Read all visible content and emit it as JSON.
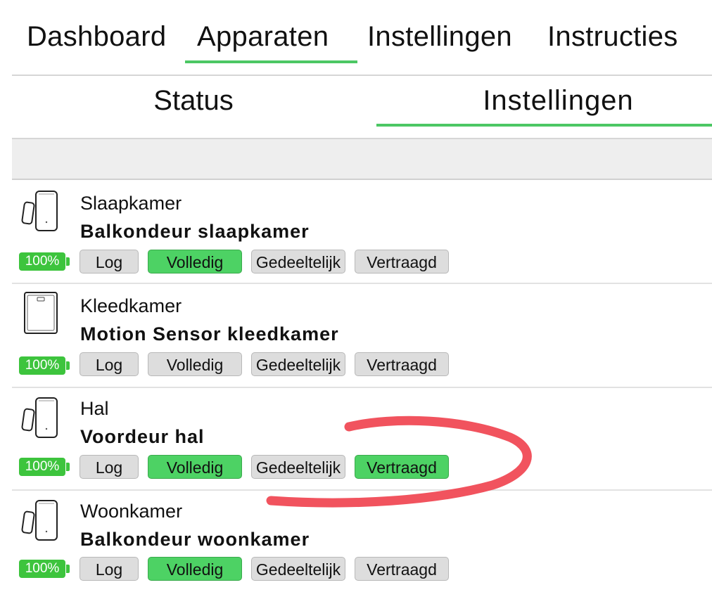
{
  "top_tabs": [
    {
      "label": "Dashboard"
    },
    {
      "label": "Apparaten"
    },
    {
      "label": "Instellingen"
    },
    {
      "label": "Instructies"
    }
  ],
  "top_tabs_active": "Apparaten",
  "sub_tabs": [
    {
      "label": "Status"
    },
    {
      "label": "Instellingen"
    }
  ],
  "sub_tabs_active": "Instellingen",
  "button_labels": {
    "log": "Log",
    "volledig": "Volledig",
    "gedeeltelijk": "Gedeeltelijk",
    "vertraagd": "Vertraagd"
  },
  "devices": [
    {
      "room": "Slaapkamer",
      "name": "Balkondeur slaapkamer",
      "battery": "100%",
      "icon": "door-sensor-icon",
      "active_modes": [
        "Volledig"
      ]
    },
    {
      "room": "Kleedkamer",
      "name": "Motion Sensor kleedkamer",
      "battery": "100%",
      "icon": "motion-sensor-icon",
      "active_modes": []
    },
    {
      "room": "Hal",
      "name": "Voordeur hal",
      "battery": "100%",
      "icon": "door-sensor-icon",
      "active_modes": [
        "Volledig",
        "Vertraagd"
      ]
    },
    {
      "room": "Woonkamer",
      "name": "Balkondeur woonkamer",
      "battery": "100%",
      "icon": "door-sensor-icon",
      "active_modes": [
        "Volledig"
      ]
    }
  ],
  "colors": {
    "accent_green": "#4cc764",
    "active_button": "#4dd264",
    "battery_green": "#3dc43d",
    "annotation_red": "#f04a55"
  }
}
